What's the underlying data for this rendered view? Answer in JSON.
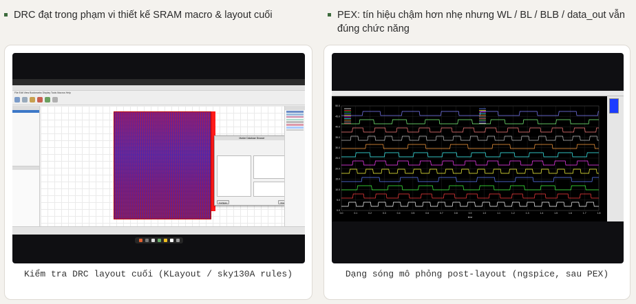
{
  "bullets": [
    {
      "text": "DRC đạt trong phạm vi thiết kế SRAM macro & layout cuối"
    },
    {
      "text": "PEX: tín hiệu chậm hơn nhẹ nhưng WL / BL / BLB / data_out vẫn đúng chức năng"
    }
  ],
  "captions": {
    "drc": "Kiểm tra DRC layout cuối (KLayout / sky130A rules)",
    "pex": "Dạng sóng mô phỏng post-layout (ngspice, sau PEX)"
  },
  "klayout": {
    "menu": "File  Edit  View  Bookmarks  Display  Tools  Macros  Help",
    "marker_db_title": "Marker Database Browser",
    "configure_label": "Configure",
    "close_label": "Close"
  },
  "waveform": {
    "x_ticks": [
      "0.0",
      "0.1",
      "0.2",
      "0.3",
      "0.4",
      "0.5",
      "0.6",
      "0.7",
      "0.8",
      "0.9",
      "1.0",
      "1.1",
      "1.2",
      "1.3",
      "1.4",
      "1.5",
      "1.6",
      "1.7",
      "1.8"
    ],
    "y_ticks": [
      "50.0",
      "45.0",
      "40.0",
      "35.0",
      "30.0",
      "25.0",
      "20.0",
      "15.0",
      "10.0",
      "5.0",
      "0.0"
    ],
    "xlabel": "time"
  },
  "colors": {
    "bullet": "#3c6b3c",
    "chip_edge": "#ff1a1a"
  }
}
